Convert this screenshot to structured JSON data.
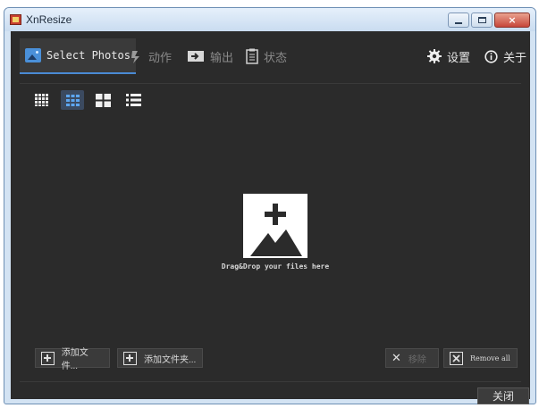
{
  "window": {
    "title": "XnResize",
    "controls": {
      "minimize": "minimize",
      "maximize": "maximize",
      "close": "×"
    }
  },
  "tabs": [
    {
      "label": "Select Photos",
      "icon": "photo-icon",
      "active": true
    },
    {
      "label": "动作",
      "icon": "action-icon",
      "active": false
    },
    {
      "label": "输出",
      "icon": "output-icon",
      "active": false
    },
    {
      "label": "状态",
      "icon": "status-icon",
      "active": false
    }
  ],
  "right_menu": [
    {
      "label": "设置",
      "icon": "gear-icon"
    },
    {
      "label": "关于",
      "icon": "info-icon"
    }
  ],
  "view_modes": [
    {
      "name": "small-grid",
      "active": false
    },
    {
      "name": "medium-grid",
      "active": true
    },
    {
      "name": "large-grid",
      "active": false
    },
    {
      "name": "list",
      "active": false
    }
  ],
  "drop_area": {
    "caption": "Drag&Drop your files here"
  },
  "buttons": {
    "add_files": "添加文件...",
    "add_folder": "添加文件夹...",
    "remove": "移除",
    "remove_all": "Remove all",
    "close": "关闭"
  },
  "colors": {
    "background": "#2b2b2b",
    "accent": "#4a8ad4",
    "text": "#e8e8e8",
    "muted": "#8a8a8a"
  }
}
